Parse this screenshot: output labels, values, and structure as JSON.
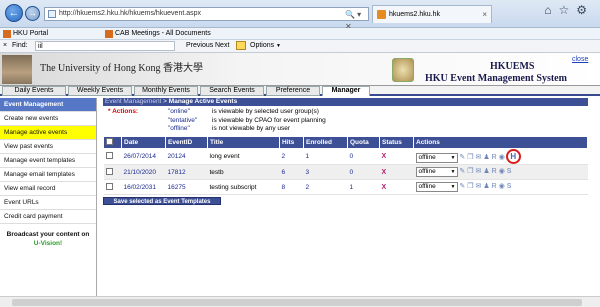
{
  "browser": {
    "address": "http://hkuems2.hku.hk/hkuems/hkuevent.aspx",
    "tabs": [
      {
        "title": "hkuems2.hku.hk"
      }
    ],
    "favorites": [
      {
        "label": "HKU Portal"
      },
      {
        "label": "CAB Meetings - All Documents"
      }
    ],
    "find": {
      "label": "Find:",
      "value": "iil",
      "previous": "Previous",
      "next": "Next",
      "options": "Options"
    }
  },
  "banner": {
    "university": "The University of Hong Kong 香港大學",
    "system_short": "HKUEMS",
    "system_full": "HKU Event Management System",
    "close": "close"
  },
  "menu": {
    "tabs": [
      {
        "label": "Daily Events"
      },
      {
        "label": "Weekly Events"
      },
      {
        "label": "Monthly Events"
      },
      {
        "label": "Search Events"
      },
      {
        "label": "Preference"
      },
      {
        "label": "Manager"
      }
    ]
  },
  "sidebar": {
    "header": "Event Management",
    "items": [
      {
        "label": "Create new events"
      },
      {
        "label": "Manage active events"
      },
      {
        "label": "View past events"
      },
      {
        "label": "Manage event templates"
      },
      {
        "label": "Manage email templates"
      },
      {
        "label": "View email record"
      },
      {
        "label": "Event URLs"
      },
      {
        "label": "Credit card payment"
      }
    ],
    "broadcast": "Broadcast your content on",
    "uvision": "U-Vision!"
  },
  "main": {
    "crumb": "Event Management",
    "sep": " > ",
    "title": "Manage Active Events",
    "actions_label": "* Actions:",
    "legend": [
      {
        "key": "\"online\"",
        "desc": "is viewable by selected user group(s)"
      },
      {
        "key": "\"tentative\"",
        "desc": "is viewable by CPAO for event planning"
      },
      {
        "key": "\"offline\"",
        "desc": "is not viewable by any user"
      }
    ],
    "columns": [
      "Date",
      "EventID",
      "Title",
      "Hits",
      "Enrolled",
      "Quota",
      "Status",
      "Actions"
    ],
    "rows": [
      {
        "date": "26/07/2014",
        "event_id": "20124",
        "title": "long event",
        "hits": "2",
        "enrolled": "1",
        "quota": "0",
        "status": "offline"
      },
      {
        "date": "21/10/2020",
        "event_id": "17812",
        "title": "testb",
        "hits": "6",
        "enrolled": "3",
        "quota": "0",
        "status": "offline"
      },
      {
        "date": "16/02/2031",
        "event_id": "16275",
        "title": "testing subscript",
        "hits": "8",
        "enrolled": "2",
        "quota": "1",
        "status": "offline"
      }
    ],
    "save_button": "Save selected as Event Templates"
  },
  "icons": {
    "status": "X",
    "h_icon": "H"
  },
  "colors": {
    "header_blue": "#3d4f95",
    "sidebar_header": "#5577c5",
    "selected": "#ffff00",
    "highlight_circle": "#d81c1c"
  }
}
